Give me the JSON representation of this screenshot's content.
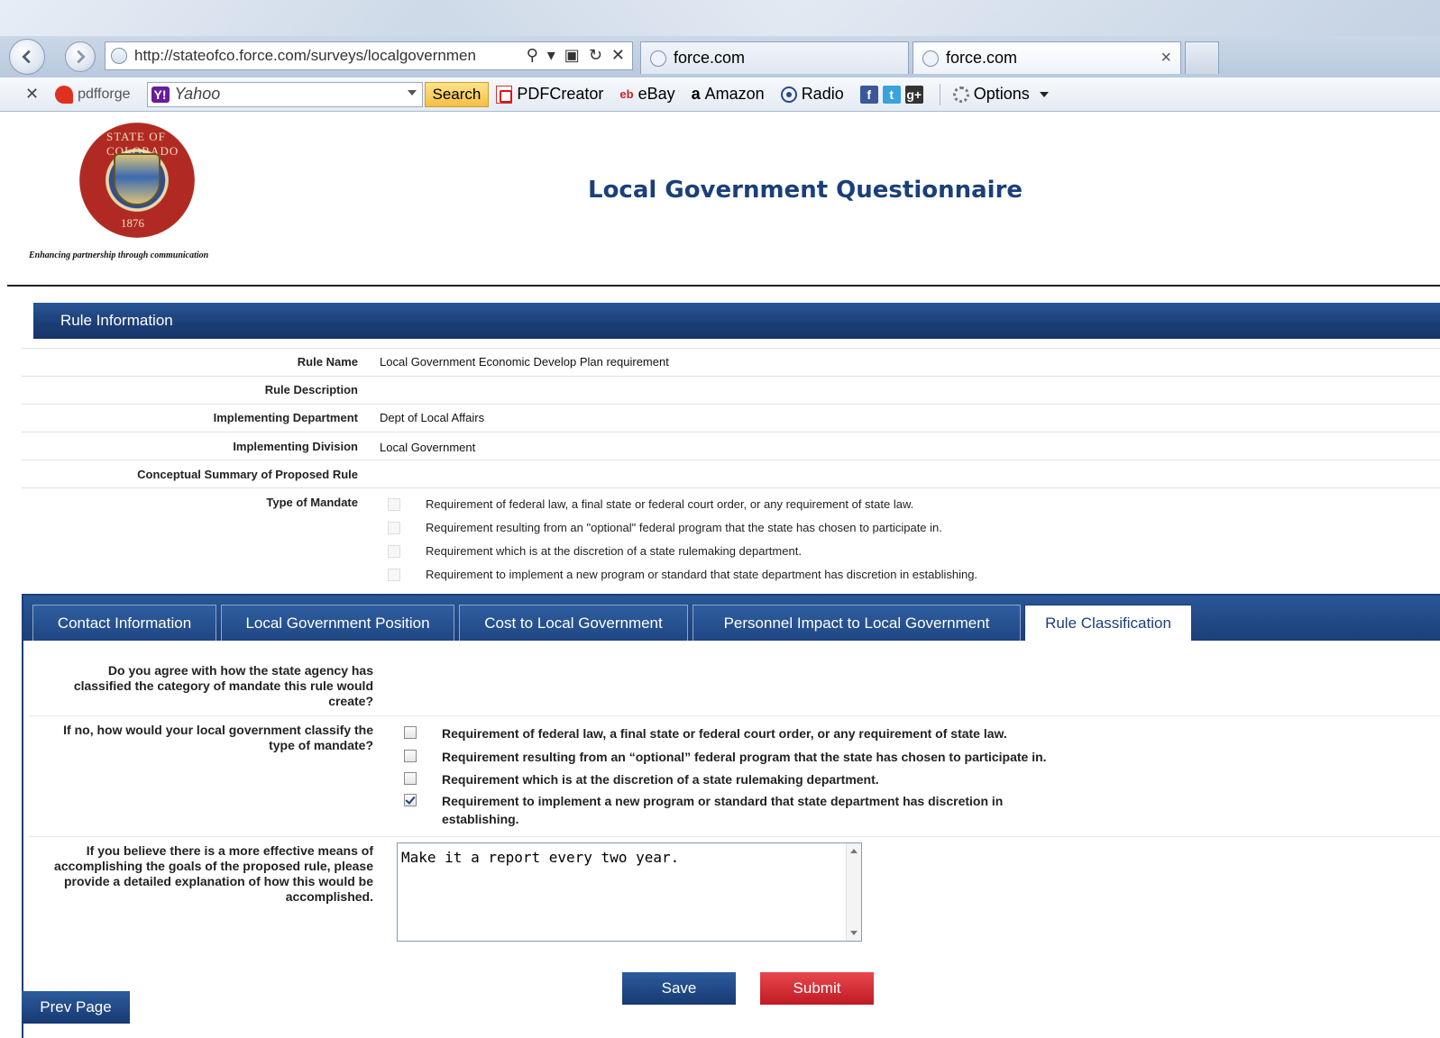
{
  "browser": {
    "address": "http://stateofco.force.com/surveys/localgovernmen",
    "tabs": [
      {
        "label": "force.com"
      },
      {
        "label": "force.com"
      }
    ]
  },
  "toolbar": {
    "pdfforge_label": "pdfforge",
    "yahoo_label": "Yahoo",
    "search_label": "Search",
    "pdfcreator_label": "PDFCreator",
    "ebay_label": "eBay",
    "amazon_label": "Amazon",
    "radio_label": "Radio",
    "options_label": "Options"
  },
  "header": {
    "title": "Local Government Questionnaire",
    "tagline": "Enhancing partnership through communication",
    "seal_year": "1876",
    "seal_text": "STATE OF COLORADO"
  },
  "rule_info": {
    "section_title": "Rule Information",
    "rows": [
      {
        "label": "Rule Name",
        "value": "Local Government Economic Develop Plan requirement"
      },
      {
        "label": "Rule Description",
        "value": ""
      },
      {
        "label": "Implementing Department",
        "value": "Dept of Local Affairs"
      },
      {
        "label": "Implementing Division",
        "value": "Local Government"
      },
      {
        "label": "Conceptual Summary of Proposed Rule",
        "value": ""
      }
    ],
    "mandate_label": "Type of Mandate",
    "mandate_options": [
      "Requirement of federal law, a final state or federal court order, or any requirement of state law.",
      "Requirement resulting from an \"optional\" federal program that the state has chosen to participate in.",
      "Requirement which is at the discretion of a state rulemaking department.",
      "Requirement to implement a new program or standard that state department has discretion in establishing."
    ]
  },
  "tabs": [
    {
      "label": "Contact Information"
    },
    {
      "label": "Local Government Position"
    },
    {
      "label": "Cost to Local Government"
    },
    {
      "label": "Personnel Impact to Local Government"
    },
    {
      "label": "Rule Classification"
    }
  ],
  "classification": {
    "q1": "Do you agree with how the state agency has classified the category of mandate this rule would create?",
    "q2": "If no, how would your local government classify the type of mandate?",
    "options": [
      {
        "label": "Requirement of federal law, a final state or federal court order, or any requirement of state law.",
        "checked": false
      },
      {
        "label": "Requirement resulting from an “optional” federal program that the state has chosen to participate in.",
        "checked": false
      },
      {
        "label": "Requirement which is at the discretion of a state rulemaking department.",
        "checked": false
      },
      {
        "label": "Requirement to implement a new program or standard that state department has discretion in establishing.",
        "checked": true
      }
    ],
    "q3": "If you believe there is a more effective means of accomplishing the goals of the proposed rule, please provide a detailed explanation of how this would be accomplished.",
    "explanation": "Make it a report every two year."
  },
  "actions": {
    "save_label": "Save",
    "submit_label": "Submit",
    "prev_label": "Prev Page"
  },
  "colors": {
    "brand_blue": "#1c3f78",
    "submit_red": "#c01b24",
    "title_blue": "#1a3f7a"
  }
}
